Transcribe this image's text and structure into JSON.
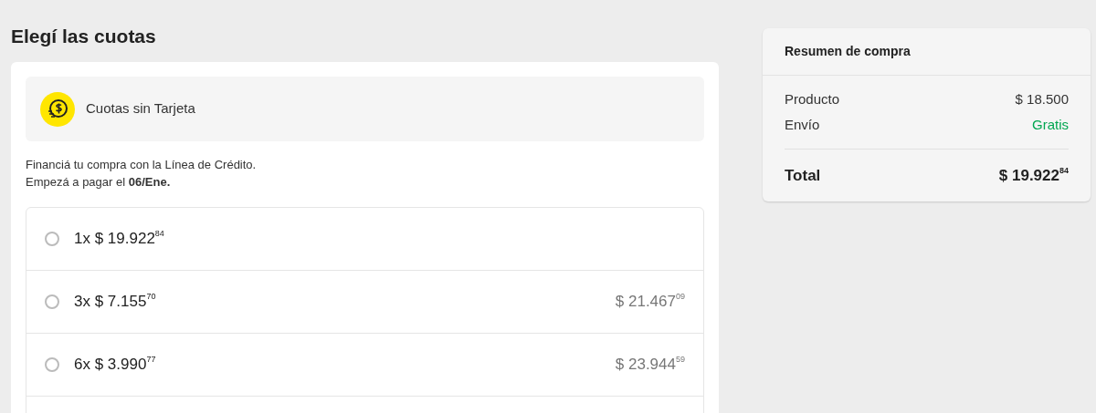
{
  "title": "Elegí las cuotas",
  "method": {
    "label": "Cuotas sin Tarjeta"
  },
  "description": [
    "Financiá tu compra con la Línea de Crédito.",
    "Empezá a pagar el **06/Ene.**"
  ],
  "installments": [
    {
      "label": "1x $ 19.922$^{84}$",
      "selected": false
    },
    {
      "label": "3x $ 7.155$^{70}$",
      "total": "$ 21.467$^{09}$",
      "selected": false
    },
    {
      "label": "6x $ 3.990$^{77}$",
      "total": "$ 23.944$^{59}$",
      "selected": false
    }
  ],
  "summary": {
    "title": "Resumen de compra",
    "lines": [
      {
        "label": "Producto",
        "value": "$ 18.500",
        "kind": "normal"
      },
      {
        "label": "Envío",
        "value": "Gratis",
        "kind": "free"
      }
    ],
    "total": {
      "label": "Total",
      "value": "$ 19.922$^{84}$"
    }
  }
}
